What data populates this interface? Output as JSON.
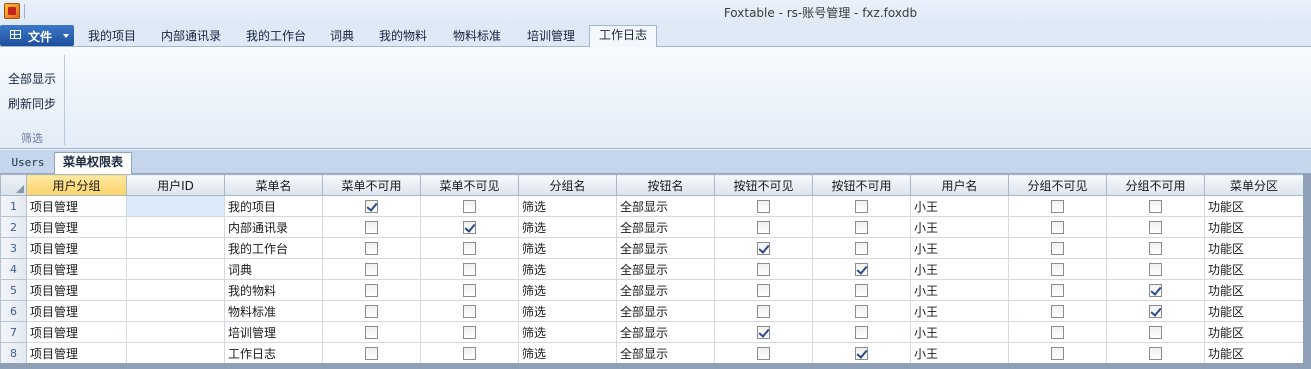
{
  "window": {
    "title": "Foxtable - rs-账号管理 - fxz.foxdb"
  },
  "ribbon": {
    "file_label": "文件",
    "tabs": [
      "我的项目",
      "内部通讯录",
      "我的工作台",
      "词典",
      "我的物料",
      "物料标准",
      "培训管理",
      "工作日志"
    ],
    "active_tab": "工作日志",
    "buttons": {
      "show_all": "全部显示",
      "refresh_sync": "刷新同步"
    },
    "group_label": "筛选"
  },
  "sheets": {
    "tabs": [
      "Users",
      "菜单权限表"
    ],
    "active": "菜单权限表"
  },
  "table": {
    "columns": [
      "用户分组",
      "用户ID",
      "菜单名",
      "菜单不可用",
      "菜单不可见",
      "分组名",
      "按钮名",
      "按钮不可见",
      "按钮不可用",
      "用户名",
      "分组不可见",
      "分组不可用",
      "菜单分区"
    ],
    "rows": [
      {
        "n": "1",
        "group": "项目管理",
        "uid": "",
        "menu": "我的项目",
        "menu_disabled": true,
        "menu_hidden": false,
        "grp": "筛选",
        "btn": "全部显示",
        "btn_hidden": false,
        "btn_disabled": false,
        "user": "小王",
        "grp_hidden": false,
        "grp_disabled": false,
        "zone": "功能区"
      },
      {
        "n": "2",
        "group": "项目管理",
        "uid": "",
        "menu": "内部通讯录",
        "menu_disabled": false,
        "menu_hidden": true,
        "grp": "筛选",
        "btn": "全部显示",
        "btn_hidden": false,
        "btn_disabled": false,
        "user": "小王",
        "grp_hidden": false,
        "grp_disabled": false,
        "zone": "功能区"
      },
      {
        "n": "3",
        "group": "项目管理",
        "uid": "",
        "menu": "我的工作台",
        "menu_disabled": false,
        "menu_hidden": false,
        "grp": "筛选",
        "btn": "全部显示",
        "btn_hidden": true,
        "btn_disabled": false,
        "user": "小王",
        "grp_hidden": false,
        "grp_disabled": false,
        "zone": "功能区"
      },
      {
        "n": "4",
        "group": "项目管理",
        "uid": "",
        "menu": "词典",
        "menu_disabled": false,
        "menu_hidden": false,
        "grp": "筛选",
        "btn": "全部显示",
        "btn_hidden": false,
        "btn_disabled": true,
        "user": "小王",
        "grp_hidden": false,
        "grp_disabled": false,
        "zone": "功能区"
      },
      {
        "n": "5",
        "group": "项目管理",
        "uid": "",
        "menu": "我的物料",
        "menu_disabled": false,
        "menu_hidden": false,
        "grp": "筛选",
        "btn": "全部显示",
        "btn_hidden": false,
        "btn_disabled": false,
        "user": "小王",
        "grp_hidden": false,
        "grp_disabled": true,
        "zone": "功能区"
      },
      {
        "n": "6",
        "group": "项目管理",
        "uid": "",
        "menu": "物料标准",
        "menu_disabled": false,
        "menu_hidden": false,
        "grp": "筛选",
        "btn": "全部显示",
        "btn_hidden": false,
        "btn_disabled": false,
        "user": "小王",
        "grp_hidden": false,
        "grp_disabled": true,
        "zone": "功能区"
      },
      {
        "n": "7",
        "group": "项目管理",
        "uid": "",
        "menu": "培训管理",
        "menu_disabled": false,
        "menu_hidden": false,
        "grp": "筛选",
        "btn": "全部显示",
        "btn_hidden": true,
        "btn_disabled": false,
        "user": "小王",
        "grp_hidden": false,
        "grp_disabled": false,
        "zone": "功能区"
      },
      {
        "n": "8",
        "group": "项目管理",
        "uid": "",
        "menu": "工作日志",
        "menu_disabled": false,
        "menu_hidden": false,
        "grp": "筛选",
        "btn": "全部显示",
        "btn_hidden": false,
        "btn_disabled": true,
        "user": "小王",
        "grp_hidden": false,
        "grp_disabled": false,
        "zone": "功能区"
      }
    ]
  }
}
